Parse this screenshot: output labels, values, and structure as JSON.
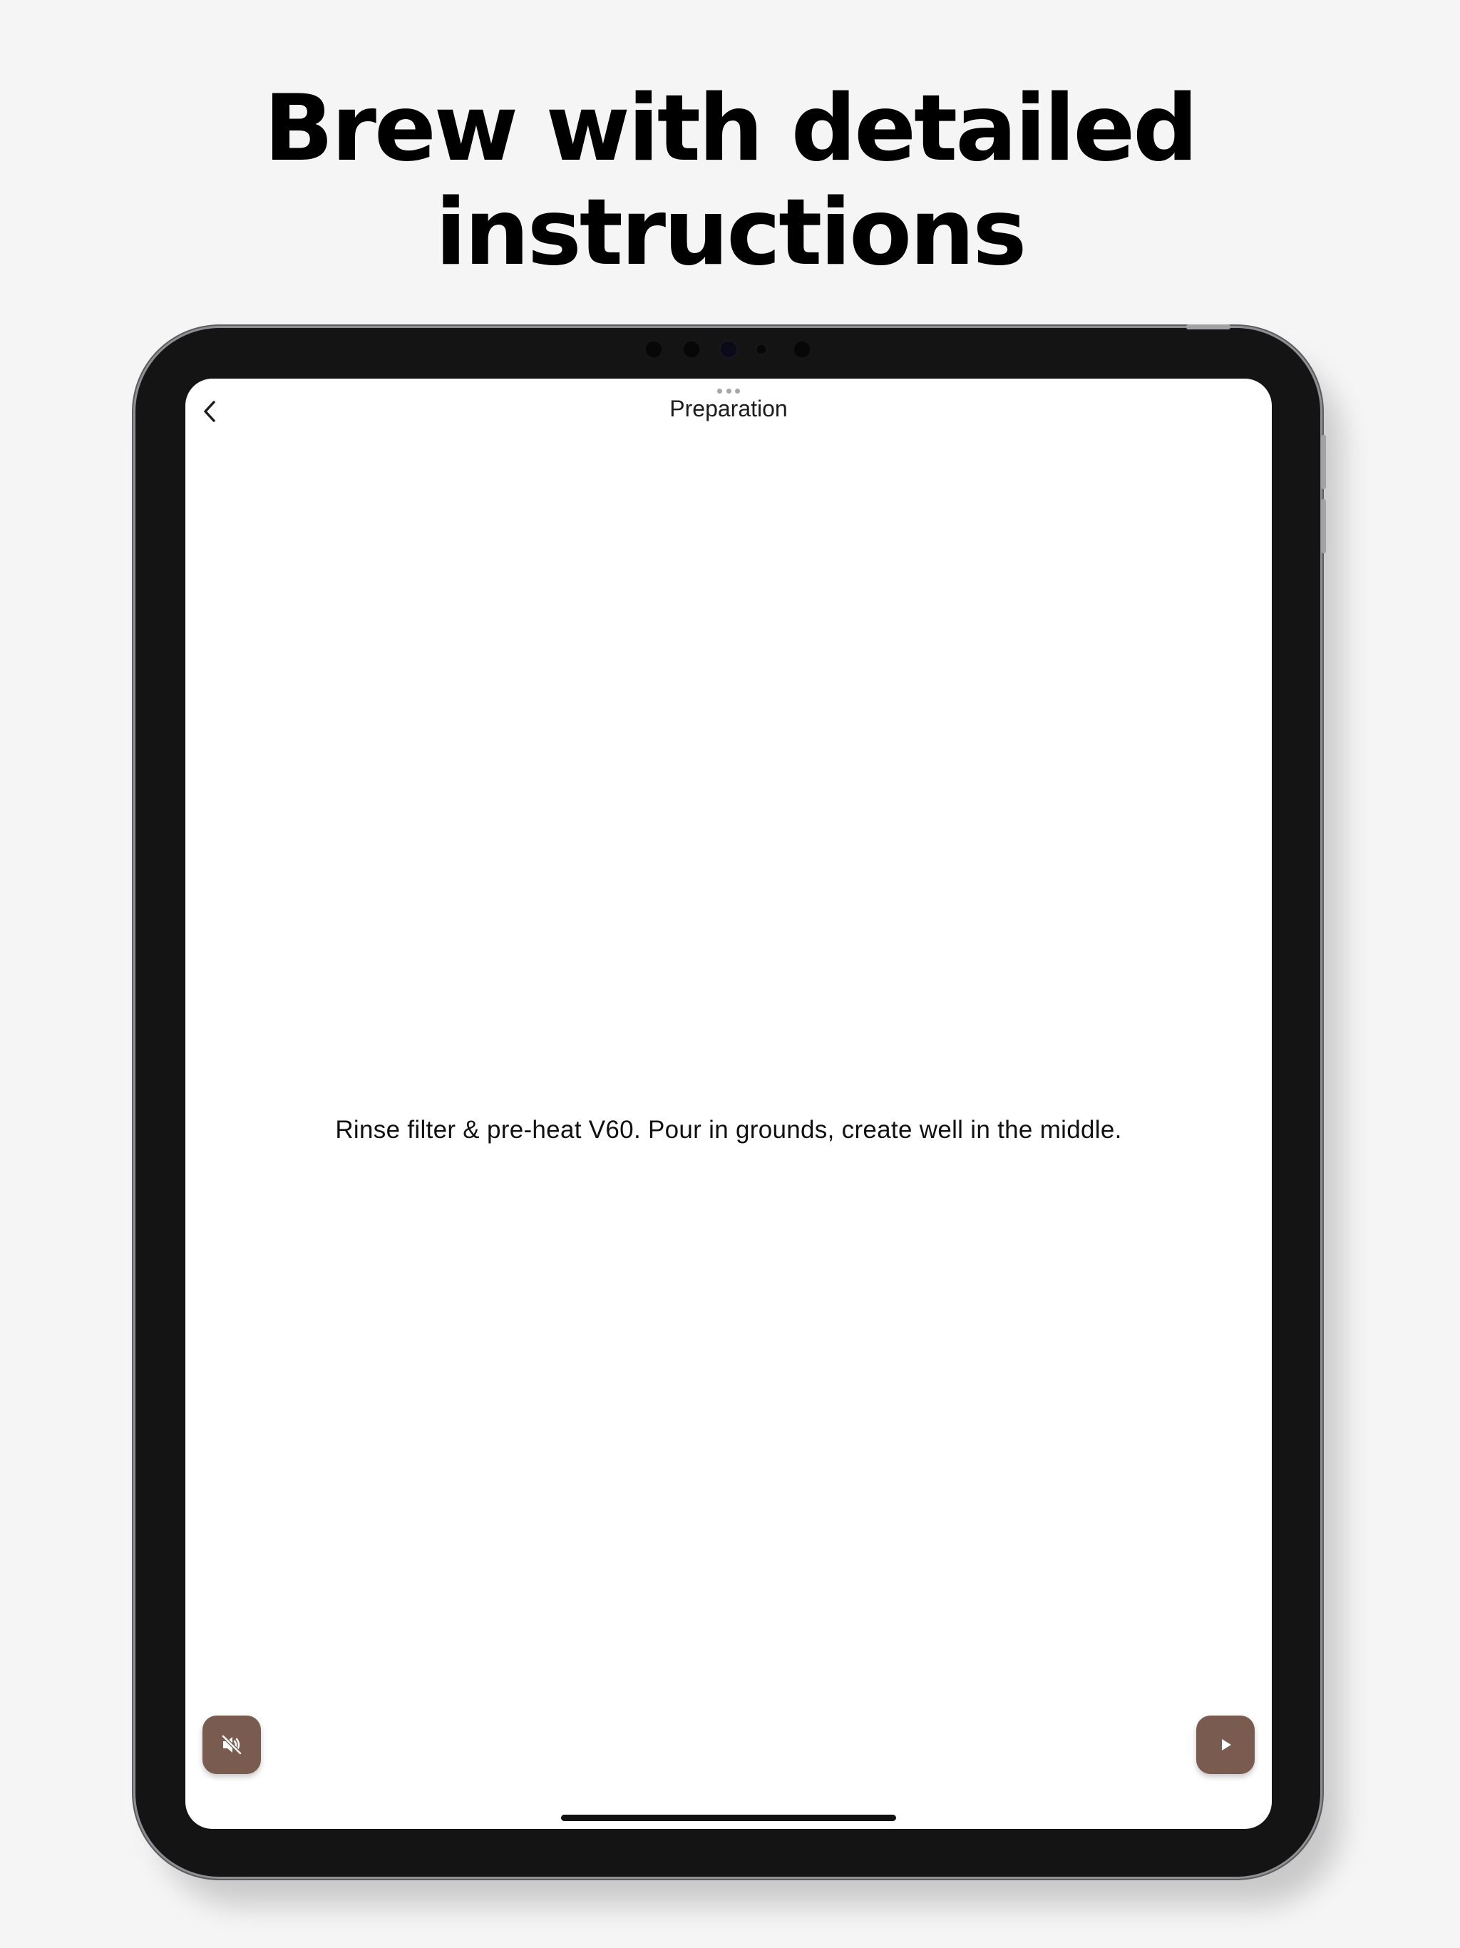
{
  "headline": {
    "line1": "Brew with detailed",
    "line2": "instructions"
  },
  "screen": {
    "nav": {
      "title": "Preparation",
      "back_icon": "chevron-left-icon"
    },
    "instruction": "Rinse filter & pre-heat V60. Pour in grounds, create well in the middle.",
    "controls": {
      "mute_icon": "speaker-muted-icon",
      "play_icon": "play-icon"
    }
  },
  "colors": {
    "background": "#f5f5f5",
    "button_brown": "#7a5b4f",
    "device_frame": "#141414"
  }
}
